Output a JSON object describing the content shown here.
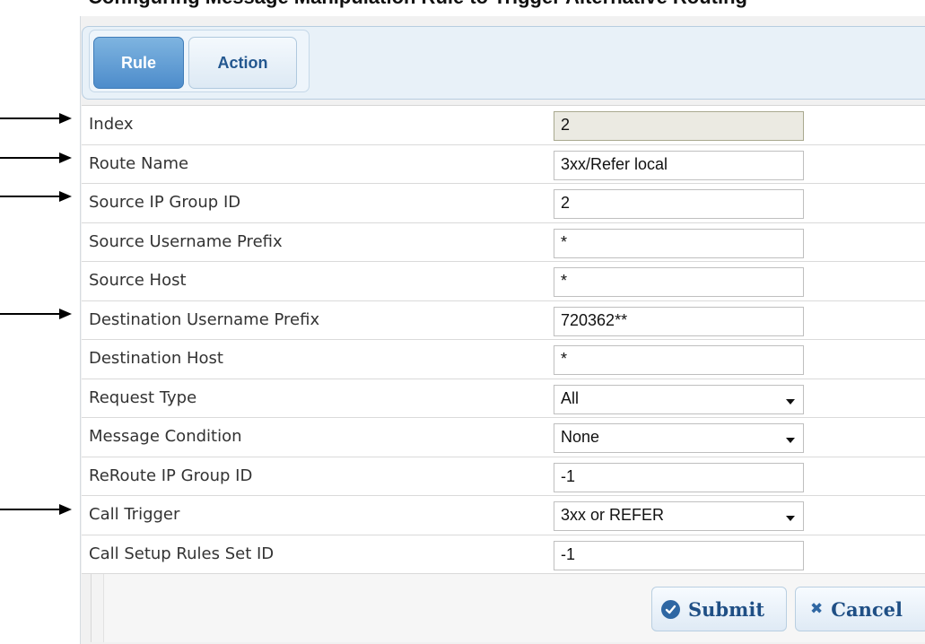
{
  "page_title": "Configuring Message Manipulation Rule to Trigger Alternative Routing",
  "tabs": [
    {
      "label": "Rule",
      "active": true
    },
    {
      "label": "Action",
      "active": false
    }
  ],
  "fields": [
    {
      "label": "Index",
      "value": "2",
      "kind": "readonly"
    },
    {
      "label": "Route Name",
      "value": "3xx/Refer local",
      "kind": "text"
    },
    {
      "label": "Source IP Group ID",
      "value": "2",
      "kind": "text"
    },
    {
      "label": "Source Username Prefix",
      "value": "*",
      "kind": "text"
    },
    {
      "label": "Source Host",
      "value": "*",
      "kind": "text"
    },
    {
      "label": "Destination Username Prefix",
      "value": "720362**",
      "kind": "text"
    },
    {
      "label": "Destination Host",
      "value": "*",
      "kind": "text"
    },
    {
      "label": "Request Type",
      "value": "All",
      "kind": "select"
    },
    {
      "label": "Message Condition",
      "value": "None",
      "kind": "select"
    },
    {
      "label": "ReRoute IP Group ID",
      "value": "-1",
      "kind": "text"
    },
    {
      "label": "Call Trigger",
      "value": "3xx or REFER",
      "kind": "select"
    },
    {
      "label": "Call Setup Rules Set ID",
      "value": "-1",
      "kind": "text"
    }
  ],
  "buttons": {
    "submit_label": "Submit",
    "cancel_label": "Cancel"
  },
  "icons": {
    "submit": "check-circle-icon",
    "cancel": "x-icon",
    "select": "chevron-down-icon",
    "callout": "arrow-right-icon"
  },
  "colors": {
    "accent": "#4d8ccb",
    "button_text": "#1f4f85",
    "readonly_bg": "#ebeae2"
  }
}
